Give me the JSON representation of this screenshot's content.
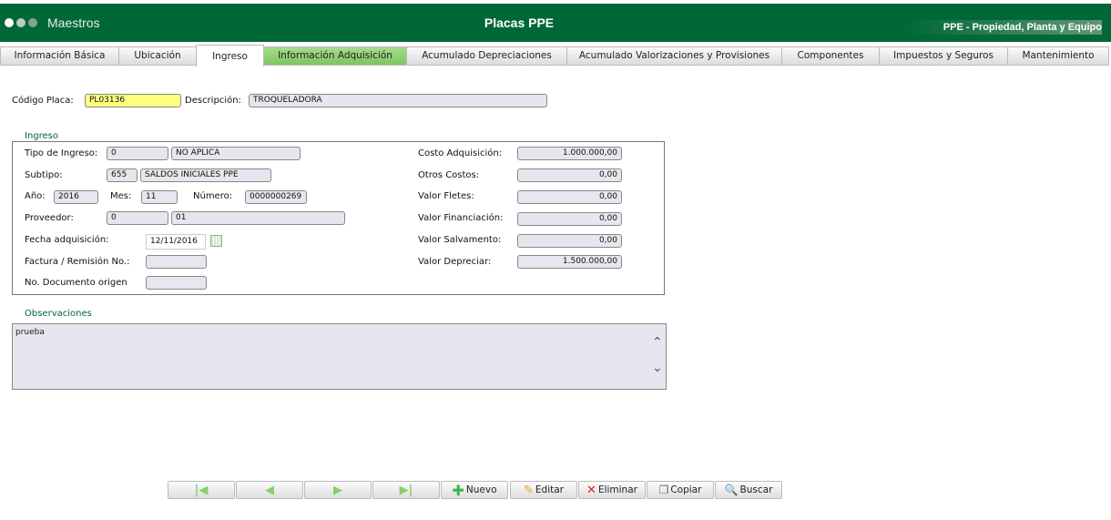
{
  "header": {
    "app_name": "Maestros",
    "title": "Placas PPE",
    "module": "PPE - Propiedad, Planta y Equipo",
    "brand_color": "#006837"
  },
  "tabs": [
    {
      "label": "Información Básica"
    },
    {
      "label": "Ubicación"
    },
    {
      "label": "Ingreso",
      "active": true
    },
    {
      "label": "Información Adquisición",
      "highlighted": true
    },
    {
      "label": "Acumulado Depreciaciones"
    },
    {
      "label": "Acumulado Valorizaciones y Provisiones"
    },
    {
      "label": "Componentes"
    },
    {
      "label": "Impuestos y Seguros"
    },
    {
      "label": "Mantenimiento"
    }
  ],
  "top": {
    "codigo_label": "Código Placa:",
    "codigo": "PL03136",
    "descripcion_label": "Descripción:",
    "descripcion": "TROQUELADORA"
  },
  "ingreso": {
    "legend": "Ingreso",
    "tipo_label": "Tipo de Ingreso:",
    "tipo_code": "0",
    "tipo_name": "NO APLICA",
    "subtipo_label": "Subtipo:",
    "subtipo_code": "655",
    "subtipo_name": "SALDOS INICIALES PPE",
    "anio_label": "Año:",
    "anio": "2016",
    "mes_label": "Mes:",
    "mes": "11",
    "numero_label": "Número:",
    "numero": "0000000269",
    "proveedor_label": "Proveedor:",
    "proveedor_code": "0",
    "proveedor_name": "01",
    "fecha_label": "Fecha adquisición:",
    "fecha": "12/11/2016",
    "factura_label": "Factura / Remisión No.:",
    "factura": "",
    "documento_label": "No. Documento origen",
    "documento": "",
    "costo_label": "Costo Adquisición:",
    "costo": "1.000.000,00",
    "otros_label": "Otros Costos:",
    "otros": "0,00",
    "fletes_label": "Valor Fletes:",
    "fletes": "0,00",
    "financiacion_label": "Valor Financiación:",
    "financiacion": "0,00",
    "salvamento_label": "Valor Salvamento:",
    "salvamento": "0,00",
    "depreciar_label": "Valor Depreciar:",
    "depreciar": "1.500.000,00"
  },
  "observaciones": {
    "legend": "Observaciones",
    "text": "prueba"
  },
  "toolbar": {
    "nuevo": "Nuevo",
    "editar": "Editar",
    "eliminar": "Eliminar",
    "copiar": "Copiar",
    "buscar": "Buscar"
  }
}
